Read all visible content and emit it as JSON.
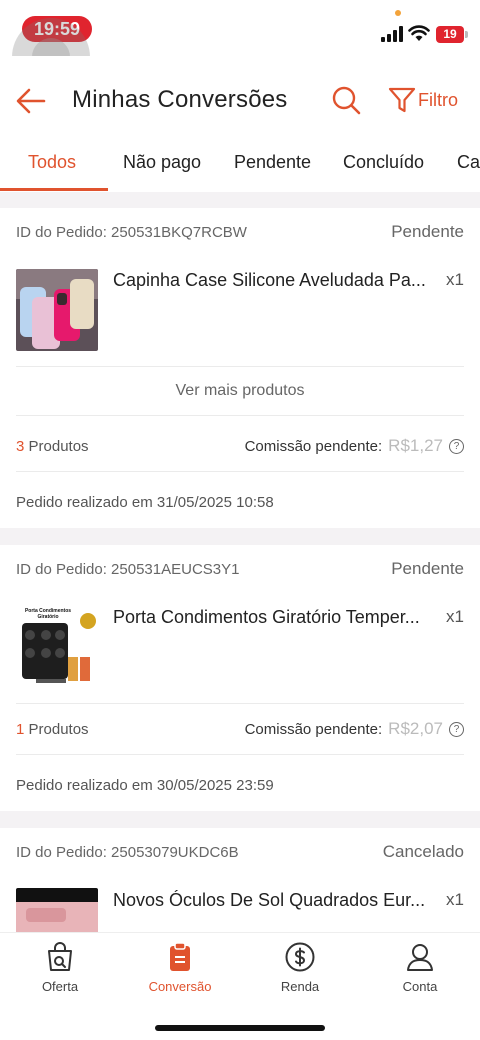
{
  "status_bar": {
    "time": "19:59",
    "battery": "19"
  },
  "header": {
    "title": "Minhas Conversões",
    "filter_label": "Filtro"
  },
  "tabs": [
    "Todos",
    "Não pago",
    "Pendente",
    "Concluído",
    "Ca"
  ],
  "orders": [
    {
      "id_label": "ID do Pedido: 250531BKQ7RCBW",
      "status": "Pendente",
      "product": "Capinha Case Silicone Aveludada Pa...",
      "qty": "x1",
      "more": "Ver mais produtos",
      "count_num": "3",
      "count_text": " Produtos",
      "commission_label": "Comissão pendente:",
      "commission_value": "R$1,27",
      "date": "Pedido realizado em 31/05/2025 10:58"
    },
    {
      "id_label": "ID do Pedido: 250531AEUCS3Y1",
      "status": "Pendente",
      "product": "Porta Condimentos Giratório Temper...",
      "qty": "x1",
      "thumb_caption": "Porta Condimentos Giratório",
      "count_num": "1",
      "count_text": " Produtos",
      "commission_label": "Comissão pendente:",
      "commission_value": "R$2,07",
      "date": "Pedido realizado em 30/05/2025 23:59"
    },
    {
      "id_label": "ID do Pedido: 25053079UKDC6B",
      "status": "Cancelado",
      "product": "Novos Óculos De Sol Quadrados Eur...",
      "qty": "x1"
    }
  ],
  "nav": [
    {
      "label": "Oferta",
      "icon": "shopping-bag-icon"
    },
    {
      "label": "Conversão",
      "icon": "clipboard-icon",
      "active": true
    },
    {
      "label": "Renda",
      "icon": "dollar-circle-icon"
    },
    {
      "label": "Conta",
      "icon": "user-icon"
    }
  ],
  "colors": {
    "accent": "#e0532e",
    "status_red": "#e0242e"
  }
}
